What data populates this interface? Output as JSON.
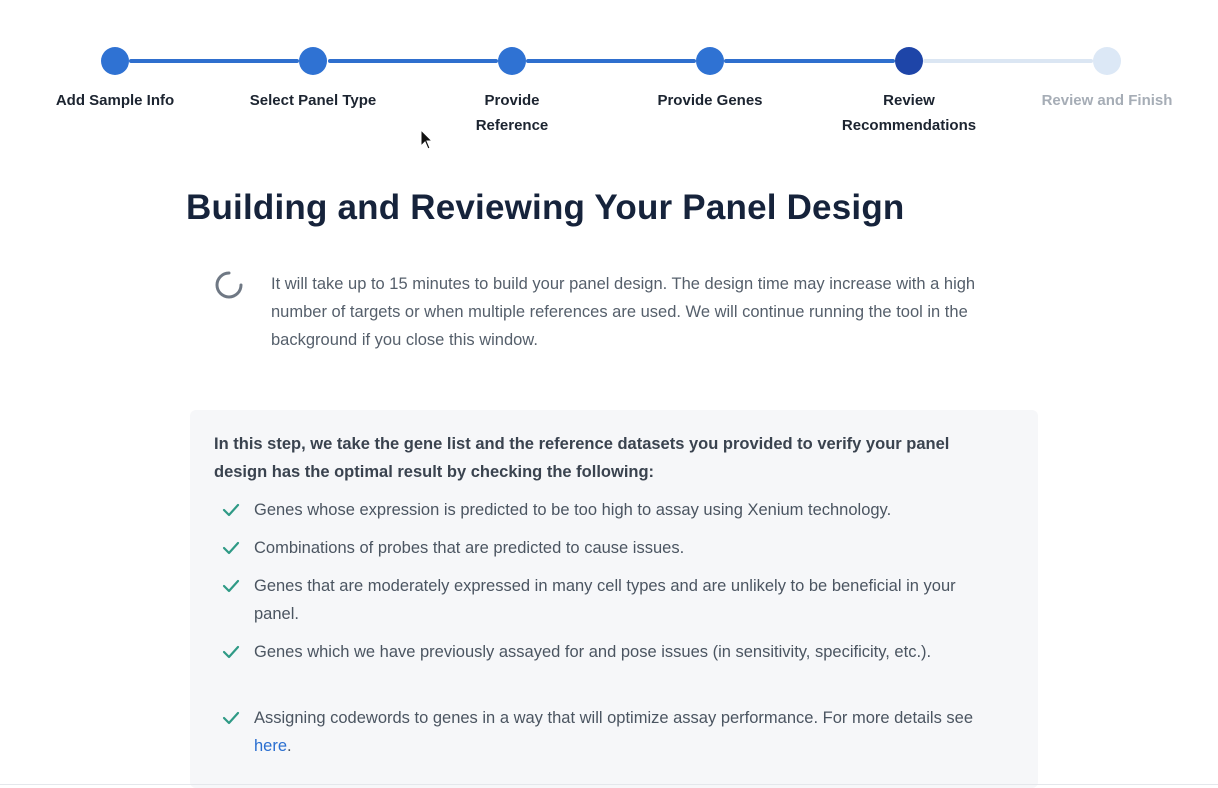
{
  "stepper": {
    "steps": [
      {
        "label": "Add Sample Info",
        "status": "done"
      },
      {
        "label": "Select Panel Type",
        "status": "done"
      },
      {
        "label": "Provide Reference",
        "status": "done"
      },
      {
        "label": "Provide Genes",
        "status": "done"
      },
      {
        "label": "Review Recommendations",
        "status": "current"
      },
      {
        "label": "Review and Finish",
        "status": "todo"
      }
    ],
    "colors": {
      "done": "#2f72d3",
      "current": "#1e45a8",
      "todo": "#dce8f6"
    }
  },
  "main": {
    "title": "Building and Reviewing Your Panel Design",
    "loading_icon": "spinner-icon",
    "loading_text": "It will take up to 15 minutes to build your panel design. The design time may increase with a high number of targets or when multiple references are used. We will continue running the tool in the background if you close this window."
  },
  "info": {
    "intro": "In this step, we take the gene list and the reference datasets you provided to verify your panel design has the optimal result by checking the following:",
    "check_icon": "check-icon",
    "items": [
      {
        "text": "Genes whose expression is predicted to be too high to assay using Xenium technology."
      },
      {
        "text": "Combinations of probes that are predicted to cause issues."
      },
      {
        "text": "Genes that are moderately expressed in many cell types and are unlikely to be beneficial in your panel."
      },
      {
        "text": "Genes which we have previously assayed for and pose issues (in sensitivity, specificity, etc.)."
      },
      {
        "text": "Assigning codewords to genes in a way that will optimize assay performance. For more details see",
        "link": "here",
        "suffix": "."
      }
    ]
  }
}
